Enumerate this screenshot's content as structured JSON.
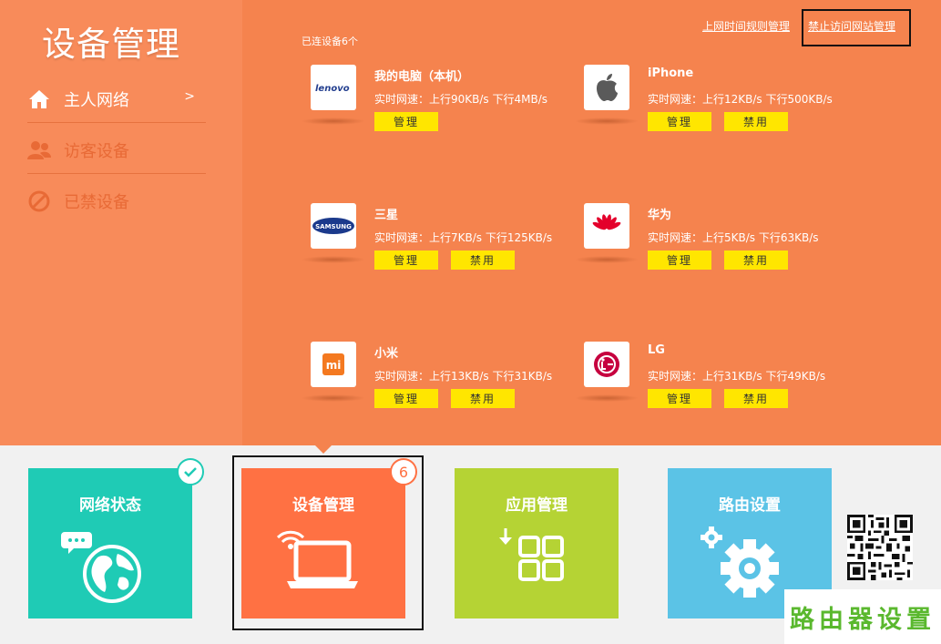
{
  "sidebar": {
    "title": "设备管理",
    "items": [
      {
        "label": "主人网络",
        "arrow": ">",
        "icon": "home-icon"
      },
      {
        "label": "访客设备",
        "icon": "users-icon"
      },
      {
        "label": "已禁设备",
        "icon": "ban-icon"
      }
    ]
  },
  "header": {
    "link_schedule": "上网时间规则管理",
    "link_block_sites": "禁止访问网站管理",
    "connected_count": "已连设备6个"
  },
  "devices": [
    {
      "name": "我的电脑（本机）",
      "speed": "实时网速：上行90KB/s  下行4MB/s",
      "manage": "管理",
      "logo": "lenovo"
    },
    {
      "name": "iPhone",
      "speed": "实时网速：上行12KB/s  下行500KB/s",
      "manage": "管理",
      "block": "禁用",
      "logo": "apple-icon"
    },
    {
      "name": "三星",
      "speed": "实时网速：上行7KB/s  下行125KB/s",
      "manage": "管理",
      "block": "禁用",
      "logo": "SAMSUNG"
    },
    {
      "name": "华为",
      "speed": "实时网速：上行5KB/s  下行63KB/s",
      "manage": "管理",
      "block": "禁用",
      "logo": "huawei-icon"
    },
    {
      "name": "小米",
      "speed": "实时网速：上行13KB/s  下行31KB/s",
      "manage": "管理",
      "block": "禁用",
      "logo": "mi"
    },
    {
      "name": "LG",
      "speed": "实时网速：上行31KB/s  下行49KB/s",
      "manage": "管理",
      "block": "禁用",
      "logo": "lg-icon"
    }
  ],
  "tiles": [
    {
      "label": "网络状态",
      "color": "#1fcbb5",
      "icon": "globe-icon",
      "badge": "check-icon"
    },
    {
      "label": "设备管理",
      "color": "#ff7143",
      "icon": "laptop-wifi-icon",
      "badge": "6"
    },
    {
      "label": "应用管理",
      "color": "#b5d334",
      "icon": "apps-grid-icon"
    },
    {
      "label": "路由设置",
      "color": "#5bc3e6",
      "icon": "gear-icon"
    }
  ],
  "watermark": "路由器设置",
  "colors": {
    "top_bg": "#f5834e",
    "sidebar_bg": "#f88b5a",
    "button": "#ffe600"
  }
}
